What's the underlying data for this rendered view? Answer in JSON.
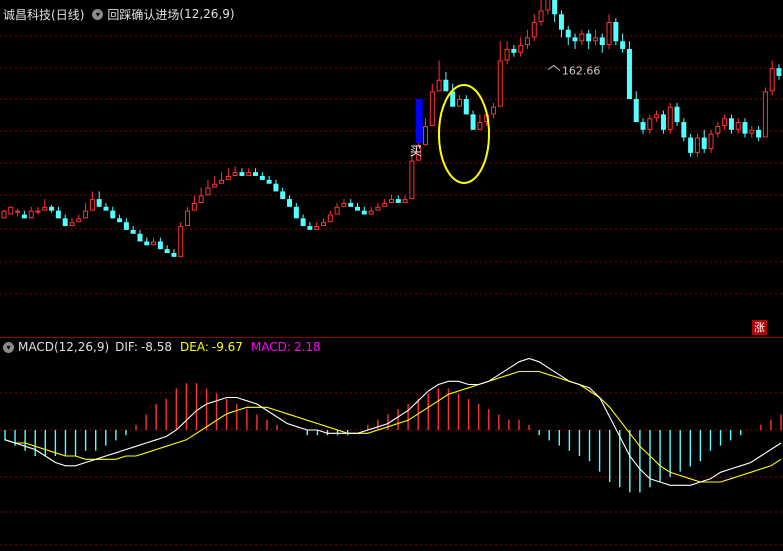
{
  "header": {
    "stock_name": "诚昌科技",
    "period": "(日线)",
    "indicator_name": "回踩确认进场",
    "indicator_params": "(12,26,9)",
    "dropdown_icon": "chevron-down-icon"
  },
  "macd_header": {
    "name": "MACD(12,26,9)",
    "dif_label": "DIF:",
    "dif_value": "-8.58",
    "dea_label": "DEA:",
    "dea_value": "-9.67",
    "macd_label": "MACD:",
    "macd_value": "2.18"
  },
  "annotations": {
    "peak_price": "162.66",
    "buy_label": "买",
    "zhang_badge": "涨"
  },
  "colors": {
    "background": "#000000",
    "up": "#ff3232",
    "down": "#54ffff",
    "grid": "#8a0000",
    "dif_line": "#ffffff",
    "dea_line": "#ffff00",
    "highlight_ellipse": "#ffff00",
    "buy_bar": "#0000ff",
    "dea_text": "#ffff00",
    "macd_text": "#ff00ff"
  },
  "chart_data": [
    {
      "type": "candlestick",
      "title": "",
      "price_range": [
        95,
        175
      ],
      "peak_annotation": 162.66,
      "candles": [
        [
          -1,
          1,
          0,
          1.2,
          -1.2
        ],
        [
          0,
          2,
          0,
          2,
          -0.5
        ],
        [
          1,
          1,
          -0.5,
          1.5,
          -1
        ],
        [
          0,
          -1,
          -1,
          1,
          -3
        ],
        [
          -1,
          1,
          -1,
          2,
          -1.5
        ],
        [
          1,
          1,
          0,
          2,
          -0.5
        ],
        [
          1,
          2,
          1,
          4,
          0
        ],
        [
          2,
          1,
          0.5,
          2.5,
          -1
        ],
        [
          1,
          -1,
          -1,
          2,
          -2
        ],
        [
          -1,
          -3,
          -3,
          0,
          -4
        ],
        [
          -3,
          -2,
          -3,
          -1,
          -4.5
        ],
        [
          -2,
          -1,
          -2,
          0,
          -3
        ],
        [
          -1,
          1,
          -1,
          3,
          -2
        ],
        [
          1,
          4,
          1,
          6,
          0
        ],
        [
          4,
          2,
          2,
          6,
          1
        ],
        [
          2,
          1,
          1,
          3,
          0
        ],
        [
          1,
          -1,
          -1,
          2,
          -2
        ],
        [
          -1,
          -2,
          -2,
          0,
          -3
        ],
        [
          -2,
          -4,
          -4,
          -1,
          -5
        ],
        [
          -4,
          -5,
          -5,
          -3,
          -6.5
        ],
        [
          -5,
          -7,
          -7,
          -4,
          -8
        ],
        [
          -7,
          -8,
          -8,
          -6,
          -9.5
        ],
        [
          -8,
          -7,
          -8,
          -6,
          -9
        ],
        [
          -7,
          -9,
          -9,
          -6,
          -10.5
        ],
        [
          -9,
          -10,
          -10,
          -8,
          -12
        ],
        [
          -10,
          -11,
          -11,
          -9,
          -12.5
        ],
        [
          -11,
          -3,
          -11,
          -2,
          -12
        ],
        [
          -3,
          1,
          -3,
          2,
          -4
        ],
        [
          1,
          3,
          1,
          5,
          0
        ],
        [
          3,
          5,
          3,
          7,
          2
        ],
        [
          5,
          7,
          5,
          9,
          4
        ],
        [
          7,
          8,
          7,
          10,
          6
        ],
        [
          8,
          9,
          8,
          11,
          7
        ],
        [
          9,
          10,
          9,
          12,
          8
        ],
        [
          10,
          11,
          10,
          12.5,
          9
        ],
        [
          11,
          10,
          10,
          12,
          9
        ],
        [
          10,
          11,
          10,
          12,
          9
        ],
        [
          11,
          10,
          10,
          12,
          9
        ],
        [
          10,
          9,
          9,
          11,
          8
        ],
        [
          9,
          8,
          8,
          10,
          7
        ],
        [
          8,
          6,
          6,
          9,
          5
        ],
        [
          6,
          4,
          4,
          7,
          3
        ],
        [
          4,
          2,
          2,
          5,
          1
        ],
        [
          2,
          -1,
          -1,
          3,
          -2
        ],
        [
          -1,
          -3,
          -3,
          0,
          -4
        ],
        [
          -3,
          -4,
          -4,
          -2,
          -5
        ],
        [
          -4,
          -3,
          -4,
          -2,
          -5
        ],
        [
          -3,
          -2,
          -3,
          -1,
          -4
        ],
        [
          -2,
          0,
          -2,
          1,
          -3
        ],
        [
          0,
          2,
          0,
          3,
          -1
        ],
        [
          2,
          3,
          2,
          4,
          1
        ],
        [
          3,
          2,
          2,
          4,
          1
        ],
        [
          2,
          1,
          1,
          3,
          0
        ],
        [
          1,
          0,
          0,
          2,
          -1
        ],
        [
          0,
          1,
          0,
          2,
          -1
        ],
        [
          1,
          2,
          1,
          3,
          0
        ],
        [
          2,
          3,
          2,
          4,
          1
        ],
        [
          3,
          4,
          3,
          5,
          2
        ],
        [
          4,
          3,
          3,
          5,
          2
        ],
        [
          3,
          4,
          3,
          5,
          2
        ],
        [
          4,
          14,
          4,
          16,
          3
        ],
        [
          14,
          18,
          14,
          20,
          13
        ],
        [
          18,
          23,
          18,
          25,
          17
        ],
        [
          23,
          32,
          23,
          34,
          22
        ],
        [
          32,
          35,
          32,
          40,
          31
        ],
        [
          35,
          32,
          32,
          37,
          31
        ],
        [
          32,
          28,
          28,
          34,
          27
        ],
        [
          28,
          30,
          28,
          31,
          26
        ],
        [
          30,
          26,
          26,
          31,
          25
        ],
        [
          26,
          22,
          22,
          27,
          21
        ],
        [
          22,
          24,
          22,
          26,
          21
        ],
        [
          24,
          26,
          23,
          27,
          22
        ],
        [
          26,
          28,
          25,
          29,
          24
        ],
        [
          28,
          40,
          28,
          45,
          27
        ],
        [
          40,
          43,
          39,
          45,
          38
        ],
        [
          43,
          42,
          41,
          44,
          40
        ],
        [
          42,
          44,
          41,
          46,
          40
        ],
        [
          44,
          46,
          43,
          48,
          42
        ],
        [
          46,
          50,
          45,
          52,
          44
        ],
        [
          50,
          53,
          49,
          56,
          48
        ],
        [
          53,
          60,
          52,
          66.7,
          51
        ],
        [
          60,
          52,
          50,
          61,
          49
        ],
        [
          52,
          48,
          46,
          53,
          45
        ],
        [
          48,
          46,
          44,
          49,
          43
        ],
        [
          46,
          45,
          43,
          47,
          42
        ],
        [
          45,
          47,
          44,
          48,
          43
        ],
        [
          47,
          45,
          43,
          48,
          42
        ],
        [
          45,
          46,
          44,
          48,
          42
        ],
        [
          46,
          44,
          42,
          47,
          41
        ],
        [
          44,
          50,
          43,
          52,
          42
        ],
        [
          50,
          45,
          44,
          51,
          43
        ],
        [
          45,
          43,
          42,
          47,
          41
        ],
        [
          43,
          30,
          30,
          45,
          28
        ],
        [
          30,
          24,
          24,
          32,
          22
        ],
        [
          24,
          22,
          21,
          25,
          20
        ],
        [
          22,
          25,
          21,
          26,
          20
        ],
        [
          25,
          26,
          24,
          27,
          23
        ],
        [
          26,
          22,
          21,
          27,
          20
        ],
        [
          22,
          28,
          21,
          29,
          20
        ],
        [
          28,
          24,
          23,
          29,
          22
        ],
        [
          24,
          20,
          19,
          25,
          18
        ],
        [
          20,
          16,
          15,
          21,
          14
        ],
        [
          16,
          20,
          15,
          21,
          14
        ],
        [
          20,
          17,
          16,
          22,
          15
        ],
        [
          17,
          21,
          16,
          22,
          15
        ],
        [
          21,
          23,
          20,
          24,
          19
        ],
        [
          23,
          25,
          22,
          26,
          21
        ],
        [
          25,
          22,
          21,
          26,
          20
        ],
        [
          22,
          24,
          21,
          25,
          20
        ],
        [
          24,
          21,
          20,
          25,
          19
        ],
        [
          21,
          22,
          20,
          23,
          19
        ],
        [
          22,
          20,
          19,
          23,
          18
        ],
        [
          20,
          32,
          20,
          33,
          19
        ],
        [
          32,
          38,
          31,
          40,
          30
        ],
        [
          38,
          36,
          35,
          39,
          34
        ]
      ],
      "note_candles": "each candle = [open, close, low, high] relative to base price 125; values in price units",
      "base_price": 125,
      "buy_signal_index": 61,
      "buy_bar": [
        117,
        143
      ]
    },
    {
      "type": "line",
      "title": "MACD(12,26,9)",
      "y_range": [
        -20,
        24
      ],
      "series": [
        {
          "name": "DIF",
          "values": [
            -3,
            -4,
            -5,
            -6,
            -8,
            -10,
            -11,
            -11,
            -10,
            -9,
            -8,
            -7,
            -6,
            -5,
            -4,
            -3,
            -2,
            0,
            3,
            6,
            8,
            9,
            10,
            10,
            9,
            8,
            6,
            4,
            2,
            1,
            0,
            0,
            -1,
            -1,
            -1,
            -1,
            0,
            1,
            2,
            4,
            6,
            9,
            12,
            14,
            15,
            15,
            14,
            14,
            15,
            17,
            19,
            21,
            22,
            21,
            19,
            17,
            15,
            14,
            13,
            10,
            4,
            -2,
            -8,
            -12,
            -15,
            -16,
            -17,
            -17,
            -17,
            -16,
            -15,
            -13,
            -12,
            -11,
            -10,
            -8,
            -6,
            -4
          ]
        },
        {
          "name": "DEA",
          "values": [
            -3,
            -4,
            -4,
            -5,
            -6,
            -7,
            -8,
            -8,
            -9,
            -9,
            -9,
            -9,
            -8,
            -8,
            -7,
            -6,
            -5,
            -4,
            -3,
            -1,
            1,
            3,
            5,
            6,
            7,
            7,
            7,
            6,
            5,
            4,
            3,
            2,
            1,
            0,
            -1,
            -1,
            -1,
            0,
            1,
            2,
            3,
            5,
            7,
            9,
            11,
            12,
            13,
            14,
            15,
            16,
            17,
            18,
            18,
            18,
            17,
            16,
            15,
            14,
            12,
            10,
            7,
            3,
            -1,
            -5,
            -8,
            -11,
            -13,
            -14,
            -15,
            -16,
            -16,
            -16,
            -15,
            -14,
            -13,
            -12,
            -11,
            -9
          ]
        },
        {
          "name": "MACD",
          "values": [
            -2,
            -3,
            -4,
            -5,
            -5,
            -5,
            -5,
            -5,
            -4,
            -4,
            -3,
            -2,
            -1,
            1,
            3,
            5,
            6,
            8,
            9,
            9,
            8,
            7,
            6,
            5,
            4,
            3,
            2,
            1,
            0,
            0,
            -1,
            -1,
            -1,
            -1,
            -1,
            0,
            1,
            2,
            3,
            4,
            5,
            6,
            7,
            8,
            8,
            7,
            6,
            5,
            4,
            3,
            2,
            2,
            1,
            -1,
            -2,
            -3,
            -4,
            -5,
            -6,
            -8,
            -10,
            -11,
            -12,
            -12,
            -11,
            -10,
            -9,
            -8,
            -7,
            -6,
            -4,
            -3,
            -2,
            -1,
            0,
            1,
            2,
            3
          ]
        }
      ]
    }
  ]
}
